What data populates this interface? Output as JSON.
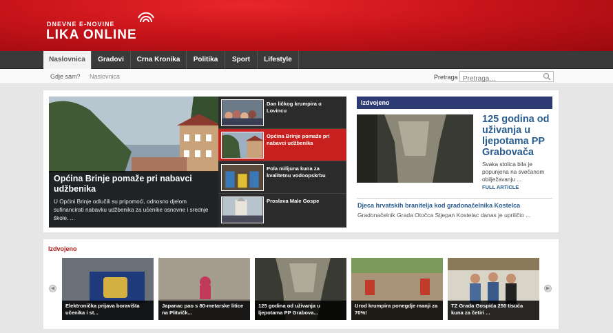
{
  "header": {
    "tagline": "DNEVNE E-NOVINE",
    "brand": "LIKA ONLINE",
    "logo_icon": "signal-arcs-icon"
  },
  "nav": [
    {
      "label": "Naslovnica",
      "active": true
    },
    {
      "label": "Gradovi"
    },
    {
      "label": "Crna Kronika"
    },
    {
      "label": "Politika"
    },
    {
      "label": "Sport"
    },
    {
      "label": "Lifestyle"
    }
  ],
  "subbar": {
    "where_label": "Gdje sam?",
    "crumb": "Naslovnica",
    "search_label": "Pretraga",
    "search_placeholder": "Pretraga..."
  },
  "featured": {
    "title": "Općina Brinje pomaže pri nabavci udžbenika",
    "text": "U Općini Brinje odlučili su pripomoći, odnosno djelom sufinancirati nabavku udžbenika za učenike osnovne i srednje škole. ..."
  },
  "list": [
    {
      "title": "Dan ličkog krumpira u Lovincu"
    },
    {
      "title": "Općina Brinje pomaže pri nabavci udžbenika",
      "active": true
    },
    {
      "title": "Pola milijuna kuna za kvalitetnu vodoopskrbu"
    },
    {
      "title": "Proslava Male Gospe"
    }
  ],
  "izdvojeno": {
    "heading": "Izdvojeno",
    "title": "125 godina od uživanja u ljepotama PP Grabovača",
    "text": "Svaka stolica bila je popunjena na svečanom obilježavanju ...",
    "more": "FULL ARTICLE",
    "second_title": "Djeca hrvatskih branitelja kod gradonačelnika Kostelca",
    "second_text": "Gradonačelnik Grada Otočca Stjepan Kostelac danas je upriličio ..."
  },
  "carousel": {
    "heading": "Izdvojeno",
    "items": [
      {
        "caption": "Elektronička prijava boravišta učenika i st..."
      },
      {
        "caption": "Japanac pao s 80-metarske litice na Plitvičk..."
      },
      {
        "caption": "125 godina od uživanja u ljepotama PP Grabova..."
      },
      {
        "caption": "Urod krumpira ponegdje manji za 70%!"
      },
      {
        "caption": "TZ Grada Gospića 250 tisuća kuna za četiri ..."
      }
    ]
  },
  "colors": {
    "header_red": "#c8141a",
    "nav_dark": "#3a3a3a",
    "accent_blue": "#2d3a73",
    "link_blue": "#2a5d8f",
    "active_red": "#c8201e"
  }
}
